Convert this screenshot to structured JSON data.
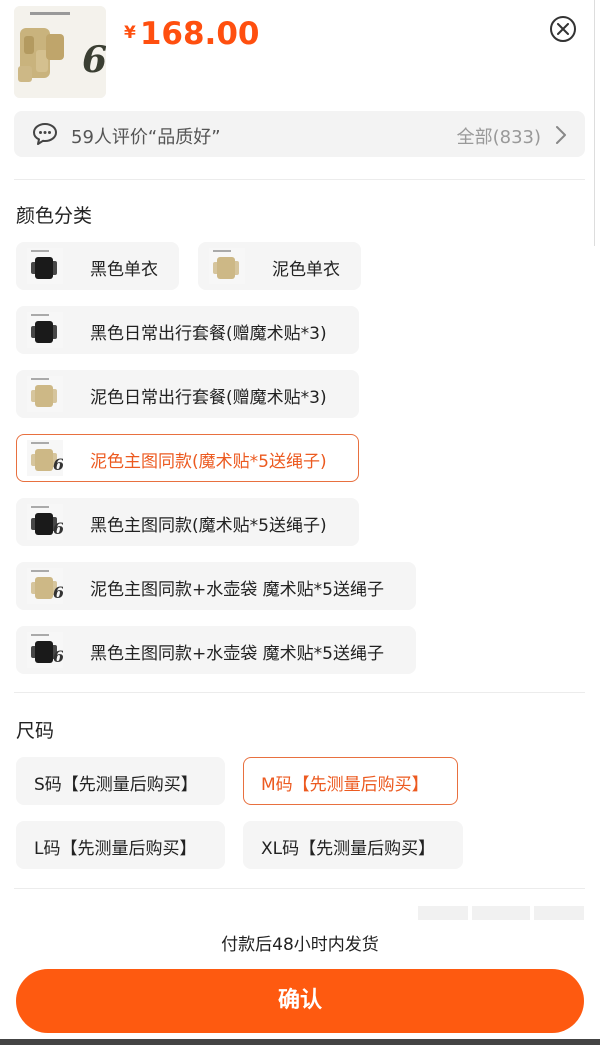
{
  "header": {
    "currency": "¥",
    "price": "168.00"
  },
  "review": {
    "summary": "59人评价“品质好”",
    "all_label": "全部(833)"
  },
  "color_section": {
    "title": "颜色分类",
    "options": [
      {
        "label": "黑色单衣",
        "tone": "black",
        "selected": false
      },
      {
        "label": "泥色单衣",
        "tone": "mud",
        "selected": false
      },
      {
        "label": "黑色日常出行套餐(赠魔术贴*3)",
        "tone": "black",
        "selected": false
      },
      {
        "label": "泥色日常出行套餐(赠魔术贴*3)",
        "tone": "mud",
        "selected": false
      },
      {
        "label": "泥色主图同款(魔术贴*5送绳子)",
        "tone": "mud",
        "selected": true
      },
      {
        "label": "黑色主图同款(魔术贴*5送绳子)",
        "tone": "black",
        "selected": false
      },
      {
        "label": "泥色主图同款+水壶袋 魔术贴*5送绳子",
        "tone": "mud",
        "selected": false
      },
      {
        "label": "黑色主图同款+水壶袋 魔术贴*5送绳子",
        "tone": "black",
        "selected": false
      }
    ]
  },
  "size_section": {
    "title": "尺码",
    "options": [
      {
        "label": "S码【先测量后购买】",
        "selected": false
      },
      {
        "label": "M码【先测量后购买】",
        "selected": true
      },
      {
        "label": "L码【先测量后购买】",
        "selected": false
      },
      {
        "label": "XL码【先测量后购买】",
        "selected": false
      }
    ]
  },
  "footer": {
    "shipping_note": "付款后48小时内发货",
    "confirm_label": "确认"
  },
  "colors": {
    "accent": "#fe5a10",
    "price": "#ff4f0f",
    "selected_border": "#e8703f",
    "option_bg": "#f5f5f5",
    "mud": "#cdb886",
    "black": "#1a1a1a"
  },
  "icons": {
    "close": "close-circle-icon",
    "chat": "chat-bubble-icon",
    "chevron": "chevron-right-icon"
  }
}
